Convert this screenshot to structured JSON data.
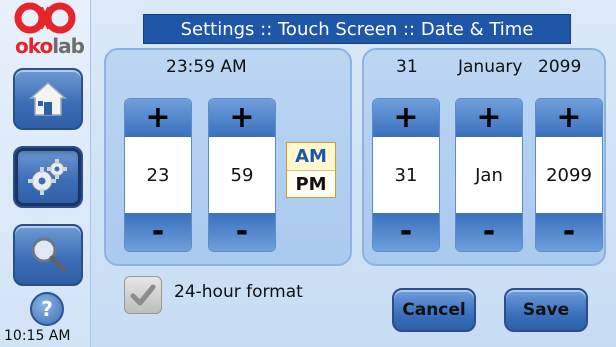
{
  "brand": {
    "name_prefix": "oko",
    "name_suffix": "lab",
    "colors": {
      "red": "#e5252a",
      "gray": "#6d6d6d"
    }
  },
  "title": "Settings :: Touch Screen :: Date & Time",
  "sidebar": {
    "items": [
      {
        "icon": "home-icon",
        "active": false
      },
      {
        "icon": "gear-icon",
        "active": true
      },
      {
        "icon": "search-icon",
        "active": false
      }
    ],
    "help_label": "?",
    "clock": "10:15 AM"
  },
  "time": {
    "display": "23:59 AM",
    "hours": "23",
    "minutes": "59",
    "am_label": "AM",
    "pm_label": "PM",
    "selected_period": "AM"
  },
  "date": {
    "day_display": "31",
    "month_display": "January",
    "year_display": "2099",
    "day": "31",
    "month": "Jan",
    "year": "2099"
  },
  "spinner_labels": {
    "plus": "+",
    "minus": "-"
  },
  "format_checkbox": {
    "label": "24-hour format",
    "checked": true
  },
  "buttons": {
    "cancel": "Cancel",
    "save": "Save"
  },
  "colors": {
    "accent": "#1f56a8",
    "button": "#3a70bd",
    "panel": "#bcd6f3"
  }
}
